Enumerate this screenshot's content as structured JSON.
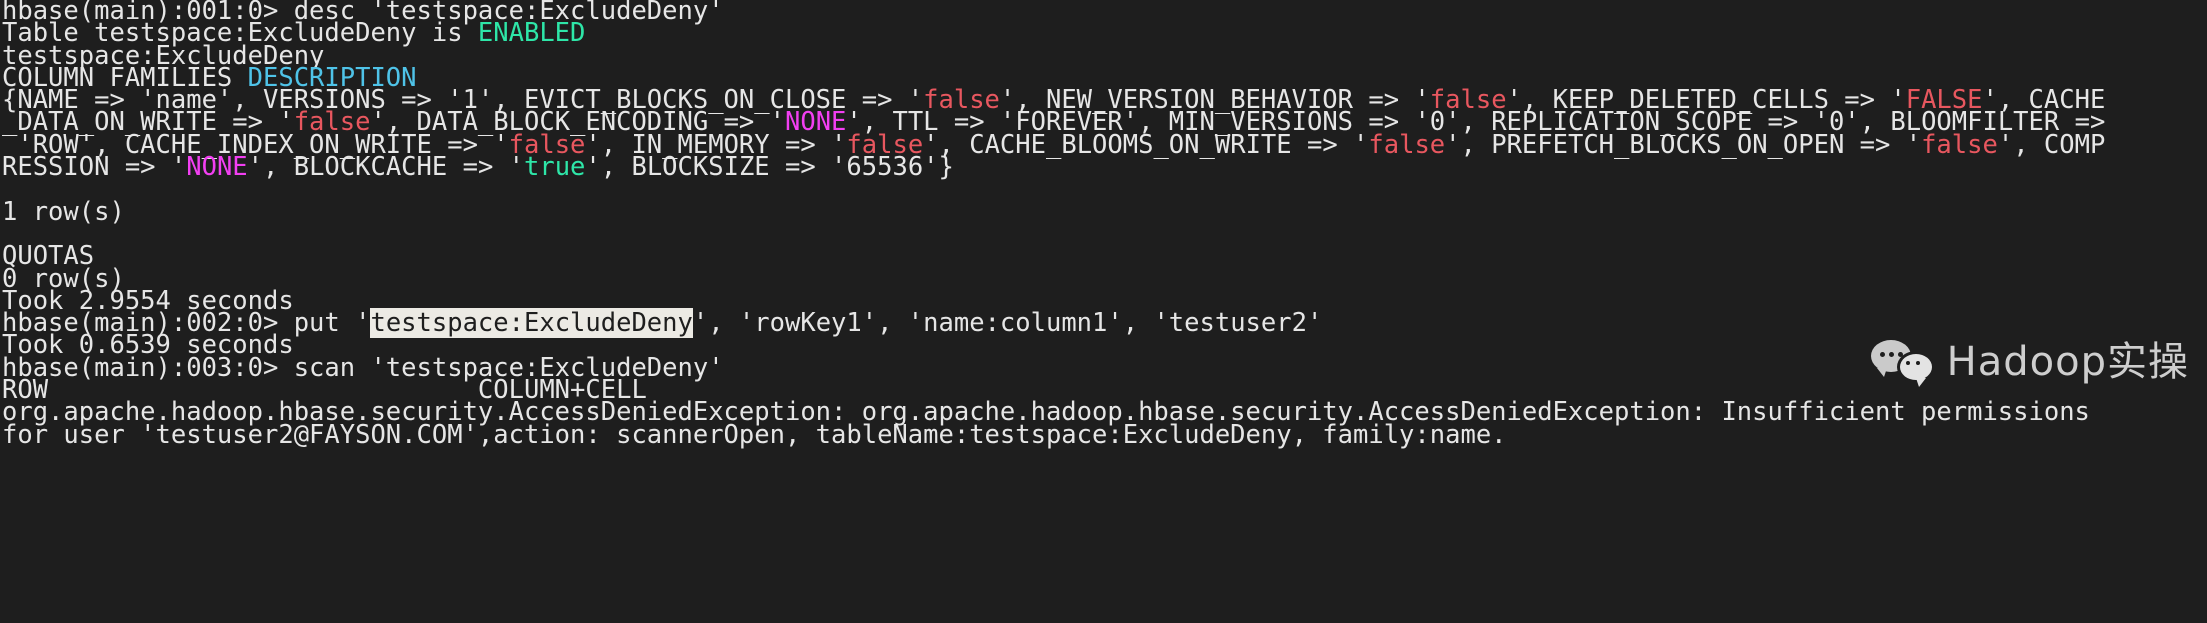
{
  "terminal": {
    "background_color": "#1e1e1e",
    "foreground_color": "#e6e6e6",
    "selection_background_color": "#eceae4",
    "selection_foreground_color": "#1e1e1e",
    "ansi_colors": {
      "green": "#2ee6a8",
      "cyan": "#4fc3e8",
      "red": "#e8575f",
      "magenta": "#f23ff2"
    }
  },
  "watermark": {
    "text": "Hadoop实操",
    "icon": "wechat-speech-bubbles-icon"
  },
  "lines": [
    {
      "id": "line-01-prompt-desc",
      "segments": [
        {
          "text": "hbase(main):001:0> desc 'testspace:ExcludeDeny'",
          "color": "default"
        }
      ]
    },
    {
      "id": "line-02-table-enabled",
      "segments": [
        {
          "text": "Table testspace:ExcludeDeny is ",
          "color": "default"
        },
        {
          "text": "ENABLED",
          "color": "green"
        }
      ]
    },
    {
      "id": "line-03-table-name",
      "segments": [
        {
          "text": "testspace:ExcludeDeny",
          "color": "default"
        }
      ]
    },
    {
      "id": "line-04-column-families-header",
      "segments": [
        {
          "text": "COLUMN FAMILIES ",
          "color": "default"
        },
        {
          "text": "DESCRIPTION",
          "color": "cyan"
        }
      ]
    },
    {
      "id": "line-05-descriptor-a",
      "segments": [
        {
          "text": "{NAME => 'name', VERSIONS => '1', EVICT_BLOCKS_ON_CLOSE => '",
          "color": "default"
        },
        {
          "text": "false",
          "color": "red"
        },
        {
          "text": "', NEW_VERSION_BEHAVIOR => '",
          "color": "default"
        },
        {
          "text": "false",
          "color": "red"
        },
        {
          "text": "', KEEP_DELETED_CELLS => '",
          "color": "default"
        },
        {
          "text": "FALSE",
          "color": "red"
        },
        {
          "text": "', CACHE",
          "color": "default"
        }
      ]
    },
    {
      "id": "line-06-descriptor-b",
      "segments": [
        {
          "text": "_DATA_ON_WRITE => '",
          "color": "default"
        },
        {
          "text": "false",
          "color": "red"
        },
        {
          "text": "', DATA_BLOCK_ENCODING => '",
          "color": "default"
        },
        {
          "text": "NONE",
          "color": "magenta"
        },
        {
          "text": "', TTL => 'FOREVER', MIN_VERSIONS => '0', REPLICATION_SCOPE => '0', BLOOMFILTER =>",
          "color": "default"
        }
      ]
    },
    {
      "id": "line-07-descriptor-c",
      "segments": [
        {
          "text": " 'ROW', CACHE_INDEX_ON_WRITE => '",
          "color": "default"
        },
        {
          "text": "false",
          "color": "red"
        },
        {
          "text": "', IN_MEMORY => '",
          "color": "default"
        },
        {
          "text": "false",
          "color": "red"
        },
        {
          "text": "', CACHE_BLOOMS_ON_WRITE => '",
          "color": "default"
        },
        {
          "text": "false",
          "color": "red"
        },
        {
          "text": "', PREFETCH_BLOCKS_ON_OPEN => '",
          "color": "default"
        },
        {
          "text": "false",
          "color": "red"
        },
        {
          "text": "', COMP",
          "color": "default"
        }
      ]
    },
    {
      "id": "line-08-descriptor-d",
      "segments": [
        {
          "text": "RESSION => '",
          "color": "default"
        },
        {
          "text": "NONE",
          "color": "magenta"
        },
        {
          "text": "', BLOCKCACHE => '",
          "color": "default"
        },
        {
          "text": "true",
          "color": "green"
        },
        {
          "text": "', BLOCKSIZE => '65536'}",
          "color": "default"
        }
      ]
    },
    {
      "id": "line-09-blank",
      "segments": [
        {
          "text": "",
          "color": "default"
        }
      ]
    },
    {
      "id": "line-10-row-count",
      "segments": [
        {
          "text": "1 row(s)",
          "color": "default"
        }
      ]
    },
    {
      "id": "line-11-blank",
      "segments": [
        {
          "text": "",
          "color": "default"
        }
      ]
    },
    {
      "id": "line-12-quotas-header",
      "segments": [
        {
          "text": "QUOTAS",
          "color": "default"
        }
      ]
    },
    {
      "id": "line-13-quotas-row-count",
      "segments": [
        {
          "text": "0 row(s)",
          "color": "default"
        }
      ]
    },
    {
      "id": "line-14-took-desc",
      "segments": [
        {
          "text": "Took 2.9554 seconds",
          "color": "default"
        }
      ]
    },
    {
      "id": "line-15-prompt-put",
      "segments": [
        {
          "text": "hbase(main):002:0> put '",
          "color": "default"
        },
        {
          "text": "testspace:ExcludeDeny",
          "color": "default",
          "selected": true
        },
        {
          "text": "', 'rowKey1', 'name:column1', 'testuser2'",
          "color": "default"
        }
      ]
    },
    {
      "id": "line-16-took-put",
      "segments": [
        {
          "text": "Took 0.6539 seconds",
          "color": "default"
        }
      ]
    },
    {
      "id": "line-17-prompt-scan",
      "segments": [
        {
          "text": "hbase(main):003:0> scan 'testspace:ExcludeDeny'",
          "color": "default"
        }
      ]
    },
    {
      "id": "line-18-scan-header",
      "segments": [
        {
          "text": "ROW                            COLUMN+CELL",
          "color": "default"
        }
      ]
    },
    {
      "id": "line-19-exception-a",
      "segments": [
        {
          "text": "org.apache.hadoop.hbase.security.AccessDeniedException: org.apache.hadoop.hbase.security.AccessDeniedException: Insufficient permissions",
          "color": "default"
        }
      ]
    },
    {
      "id": "line-20-exception-b",
      "segments": [
        {
          "text": "for user 'testuser2@FAYSON.COM',action: scannerOpen, tableName:testspace:ExcludeDeny, family:name.",
          "color": "default"
        }
      ]
    }
  ]
}
